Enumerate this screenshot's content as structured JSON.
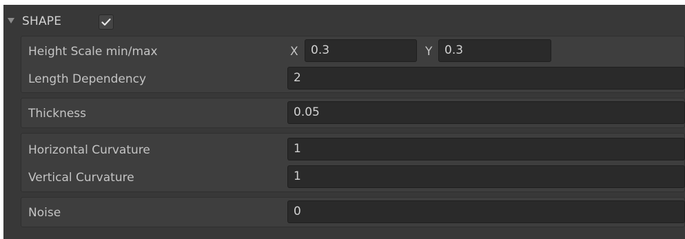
{
  "header": {
    "title": "SHAPE",
    "enabled": true,
    "foldout_icon": "triangle-down-icon",
    "checkmark_icon": "checkmark-icon"
  },
  "groups": [
    {
      "rows": [
        {
          "label": "Height Scale min/max",
          "x_label": "X",
          "x_value": "0.3",
          "y_label": "Y",
          "y_value": "0.3"
        },
        {
          "label": "Length Dependency",
          "value": "2"
        }
      ]
    },
    {
      "rows": [
        {
          "label": "Thickness",
          "value": "0.05"
        }
      ]
    },
    {
      "rows": [
        {
          "label": "Horizontal Curvature",
          "value": "1"
        },
        {
          "label": "Vertical Curvature",
          "value": "1"
        }
      ]
    },
    {
      "rows": [
        {
          "label": "Noise",
          "value": "0"
        }
      ]
    }
  ],
  "colors": {
    "panel_bg": "#383838",
    "group_bg": "#3e3e3e",
    "field_bg": "#2a2a2a",
    "text": "#c4c4c4"
  }
}
